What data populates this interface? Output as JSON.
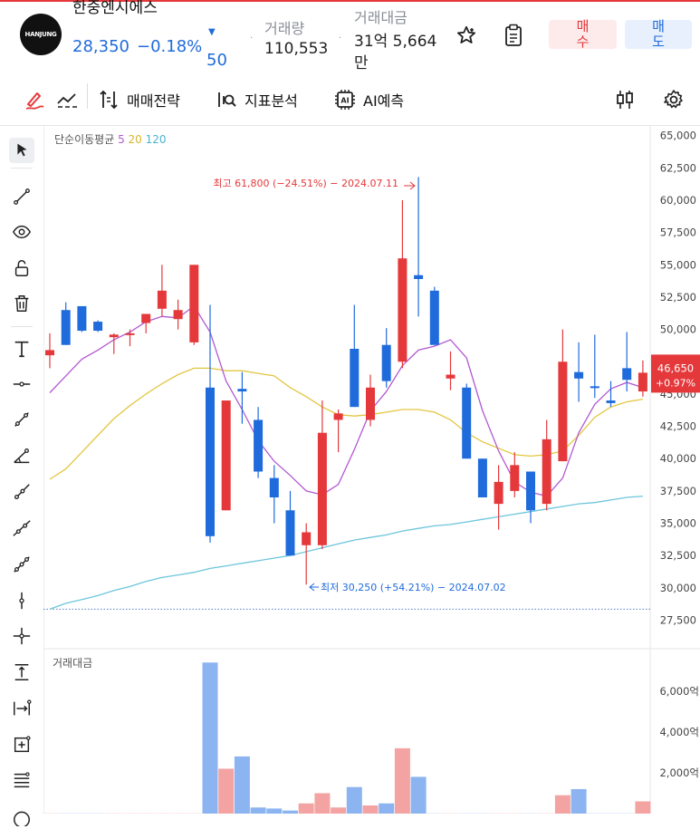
{
  "header": {
    "logo_text": "HANJUNG",
    "stock_name": "한중엔시에스",
    "price": "28,350",
    "change_pct": "−0.18%",
    "change_arrow": "▼",
    "change_value": "50",
    "volume_label": "거래량",
    "volume_value": "110,553",
    "amount_label": "거래대금",
    "amount_value_line1": "31억 5,664",
    "amount_value_line2": "만",
    "buy_label": "매\n수",
    "sell_label": "매\n도",
    "icons": [
      "star-icon",
      "clipboard-icon"
    ]
  },
  "toolbar": {
    "strategy_label": "매매전략",
    "indicator_label": "지표분석",
    "ai_label": "AI예측",
    "icons": [
      "pen-icon",
      "trend-line-icon",
      "strategy-icon",
      "indicator-icon",
      "ai-icon",
      "candle-settings-icon",
      "gear-icon"
    ]
  },
  "left_tools": [
    "cursor-icon",
    "line-icon",
    "eye-icon",
    "unlock-icon",
    "trash-icon",
    "text-icon",
    "horizontal-line-icon",
    "trend-line-icon",
    "angle-icon",
    "ray-icon",
    "extended-line-icon",
    "parallel-icon",
    "vertical-line-icon",
    "crosshair-icon",
    "price-range-icon",
    "date-range-icon",
    "measure-icon",
    "fib-icon",
    "circle-icon"
  ],
  "chart_legend": {
    "ma_label": "단순이동평균",
    "ma5": "5",
    "ma20": "20",
    "ma120": "120",
    "volume_label": "거래대금"
  },
  "colors": {
    "up": "#e5383b",
    "down": "#1f6bdc",
    "ma5": "#b25ad1",
    "ma20": "#e3c640",
    "ma120": "#6cc6dc",
    "vol_up": "#f4a3a3",
    "vol_down": "#8cb4f0"
  },
  "chart_data": {
    "type": "candlestick",
    "y_ticks": [
      "65,000",
      "62,500",
      "60,000",
      "57,500",
      "55,000",
      "52,500",
      "50,000",
      "47,500",
      "45,000",
      "42,500",
      "40,000",
      "37,500",
      "35,000",
      "32,500",
      "30,000",
      "27,500"
    ],
    "ylim": [
      25500,
      65750
    ],
    "current_price_label": "46,650",
    "current_change_label": "+0.97%",
    "current_price": 46650,
    "high_annotation": "최고 61,800 (−24.51%) − 2024.07.11",
    "low_annotation": "최저 30,250 (+54.21%) − 2024.07.02",
    "dotted_level": 28350,
    "candles": [
      {
        "o": 48000,
        "h": 49700,
        "l": 47000,
        "c": 48400,
        "up": true
      },
      {
        "o": 51500,
        "h": 52100,
        "l": 48800,
        "c": 48800,
        "up": false
      },
      {
        "o": 51800,
        "h": 51800,
        "l": 49800,
        "c": 49900,
        "up": false
      },
      {
        "o": 50600,
        "h": 50700,
        "l": 49800,
        "c": 49900,
        "up": false
      },
      {
        "o": 49600,
        "h": 49700,
        "l": 48100,
        "c": 49400,
        "up": true
      },
      {
        "o": 49700,
        "h": 50000,
        "l": 48700,
        "c": 49600,
        "up": true
      },
      {
        "o": 50500,
        "h": 51200,
        "l": 49700,
        "c": 51200,
        "up": true
      },
      {
        "o": 51600,
        "h": 55000,
        "l": 51000,
        "c": 53000,
        "up": true
      },
      {
        "o": 50800,
        "h": 52300,
        "l": 50000,
        "c": 51500,
        "up": true
      },
      {
        "o": 49000,
        "h": 55000,
        "l": 48800,
        "c": 55000,
        "up": true
      },
      {
        "o": 45500,
        "h": 51900,
        "l": 33500,
        "c": 34000,
        "up": false
      },
      {
        "o": 36000,
        "h": 44000,
        "l": 36000,
        "c": 44500,
        "up": true
      },
      {
        "o": 45400,
        "h": 46700,
        "l": 42700,
        "c": 45200,
        "up": false
      },
      {
        "o": 43000,
        "h": 44000,
        "l": 38500,
        "c": 39000,
        "up": false
      },
      {
        "o": 38500,
        "h": 39500,
        "l": 35000,
        "c": 37000,
        "up": false
      },
      {
        "o": 36000,
        "h": 37500,
        "l": 32500,
        "c": 32500,
        "up": false
      },
      {
        "o": 33300,
        "h": 35000,
        "l": 30250,
        "c": 34300,
        "up": true
      },
      {
        "o": 33300,
        "h": 44500,
        "l": 33000,
        "c": 42000,
        "up": true
      },
      {
        "o": 43000,
        "h": 43800,
        "l": 40500,
        "c": 43500,
        "up": true
      },
      {
        "o": 48500,
        "h": 51900,
        "l": 44000,
        "c": 44000,
        "up": false
      },
      {
        "o": 43000,
        "h": 46500,
        "l": 42500,
        "c": 45500,
        "up": true
      },
      {
        "o": 48800,
        "h": 50100,
        "l": 45500,
        "c": 46000,
        "up": false
      },
      {
        "o": 47500,
        "h": 60000,
        "l": 47000,
        "c": 55500,
        "up": true
      },
      {
        "o": 54200,
        "h": 61800,
        "l": 51000,
        "c": 53900,
        "up": false
      },
      {
        "o": 53000,
        "h": 53300,
        "l": 48800,
        "c": 48800,
        "up": false
      },
      {
        "o": 46200,
        "h": 48300,
        "l": 45300,
        "c": 46500,
        "up": true
      },
      {
        "o": 45500,
        "h": 45800,
        "l": 40000,
        "c": 40000,
        "up": false
      },
      {
        "o": 40000,
        "h": 40000,
        "l": 37000,
        "c": 37000,
        "up": false
      },
      {
        "o": 36500,
        "h": 39500,
        "l": 34500,
        "c": 38200,
        "up": true
      },
      {
        "o": 37500,
        "h": 40500,
        "l": 37000,
        "c": 39500,
        "up": true
      },
      {
        "o": 39000,
        "h": 39000,
        "l": 35000,
        "c": 36000,
        "up": false
      },
      {
        "o": 36500,
        "h": 43000,
        "l": 36000,
        "c": 41500,
        "up": true
      },
      {
        "o": 39800,
        "h": 50000,
        "l": 39800,
        "c": 47500,
        "up": true
      },
      {
        "o": 46700,
        "h": 49000,
        "l": 44400,
        "c": 46200,
        "up": false
      },
      {
        "o": 45600,
        "h": 49600,
        "l": 44700,
        "c": 45500,
        "up": false
      },
      {
        "o": 44500,
        "h": 46000,
        "l": 44000,
        "c": 44300,
        "up": false
      },
      {
        "o": 47000,
        "h": 49800,
        "l": 45200,
        "c": 46100,
        "up": false
      },
      {
        "o": 45200,
        "h": 47600,
        "l": 44800,
        "c": 46650,
        "up": true
      }
    ],
    "ma5": [
      45100,
      46400,
      47700,
      48400,
      49200,
      49800,
      50600,
      51000,
      50900,
      51800,
      49800,
      46000,
      43800,
      41400,
      39800,
      38700,
      37500,
      37200,
      38000,
      40700,
      43700,
      45200,
      47200,
      48400,
      48700,
      49200,
      47800,
      43700,
      40600,
      38200,
      37400,
      37100,
      38500,
      42000,
      44200,
      45400,
      45900,
      45500
    ],
    "ma20": [
      38400,
      39200,
      40500,
      41800,
      43100,
      44100,
      45000,
      45800,
      46500,
      47000,
      47000,
      46800,
      46800,
      46600,
      46400,
      45500,
      44800,
      44000,
      43400,
      43300,
      43400,
      43600,
      43800,
      43800,
      43600,
      43000,
      42000,
      41300,
      40800,
      40300,
      40200,
      40300,
      40600,
      41800,
      43200,
      44000,
      44400,
      44600
    ],
    "ma120": [
      28350,
      28800,
      29100,
      29400,
      29800,
      30100,
      30500,
      30800,
      31000,
      31200,
      31500,
      31700,
      31900,
      32100,
      32300,
      32500,
      32800,
      33100,
      33400,
      33700,
      33900,
      34100,
      34400,
      34600,
      34800,
      34900,
      35100,
      35300,
      35500,
      35700,
      35900,
      36100,
      36300,
      36500,
      36600,
      36800,
      37000,
      37100
    ],
    "volume": {
      "y_ticks": [
        "6,000억",
        "4,000억",
        "2,000억"
      ],
      "ylim": [
        0,
        7500
      ],
      "values": [
        10,
        10,
        10,
        10,
        10,
        10,
        10,
        10,
        10,
        10,
        7400,
        2200,
        2800,
        300,
        250,
        150,
        500,
        1000,
        300,
        1300,
        400,
        500,
        3200,
        1800,
        10,
        10,
        10,
        10,
        10,
        10,
        10,
        10,
        900,
        1200,
        10,
        10,
        10,
        600
      ]
    }
  }
}
